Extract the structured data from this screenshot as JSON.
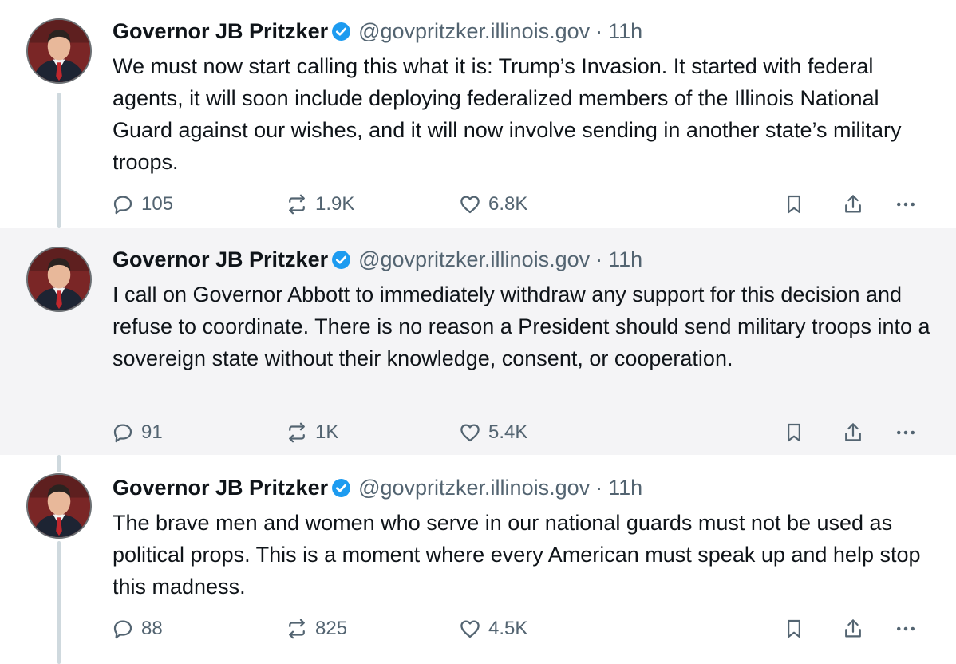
{
  "posts": [
    {
      "author": "Governor JB Pritzker",
      "handle": "@govpritzker.illinois.gov",
      "separator": "·",
      "time": "11h",
      "text": "We must now start calling this what it is: Trump’s Invasion. It started with federal agents, it will soon include deploying federalized members of the Illinois National Guard against our wishes, and it will now involve sending in another state’s military troops.",
      "replies": "105",
      "reposts": "1.9K",
      "likes": "6.8K"
    },
    {
      "author": "Governor JB Pritzker",
      "handle": "@govpritzker.illinois.gov",
      "separator": "·",
      "time": "11h",
      "text": "I call on Governor Abbott to immediately withdraw any support for this decision and refuse to coordinate. There is no reason a President should send military troops into a sovereign state without their knowledge, consent, or cooperation.",
      "replies": "91",
      "reposts": "1K",
      "likes": "5.4K"
    },
    {
      "author": "Governor JB Pritzker",
      "handle": "@govpritzker.illinois.gov",
      "separator": "·",
      "time": "11h",
      "text": "The brave men and women who serve in our national guards must not be used as political props. This is a moment where every American must speak up and help stop this madness.",
      "replies": "88",
      "reposts": "825",
      "likes": "4.5K"
    }
  ],
  "icons": {
    "reply": "reply-icon",
    "repost": "repost-icon",
    "like": "like-icon",
    "bookmark": "bookmark-icon",
    "share": "share-icon",
    "more": "more-icon",
    "verified": "verified-badge-icon"
  },
  "colors": {
    "verified": "#1d9bf0",
    "secondary_text": "#536471",
    "highlight_background": "#f4f4f6",
    "thread_line": "#cfd9de"
  }
}
